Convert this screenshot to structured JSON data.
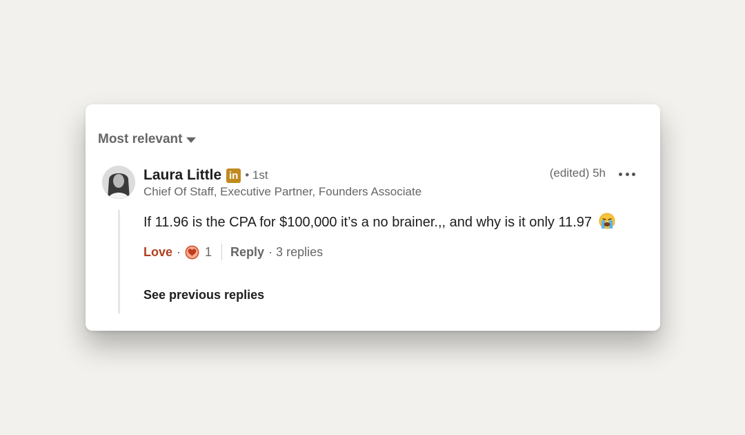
{
  "sort": {
    "label": "Most relevant",
    "icon": "caret-down-icon"
  },
  "comment": {
    "author": {
      "name": "Laura Little",
      "badge": "in",
      "badge_color": "#c08a1f",
      "degree": "• 1st",
      "headline": "Chief Of Staff, Executive Partner, Founders Associate"
    },
    "meta": "(edited) 5h",
    "text": "If 11.96 is the CPA for $100,000 it’s a no brainer.,, and why is it only 11.97",
    "emoji": "loudly-crying-face-emoji",
    "actions": {
      "love_label": "Love",
      "dot": "·",
      "reaction_icon": "love-heart-icon",
      "reaction_count": "1",
      "reply_label": "Reply",
      "replies_count": "· 3 replies"
    },
    "love_color": "#b24020"
  },
  "see_previous_replies": "See previous replies"
}
